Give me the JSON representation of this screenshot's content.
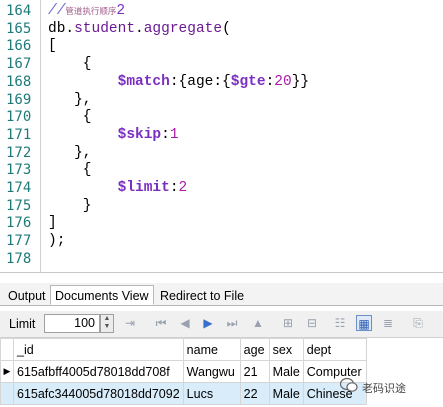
{
  "editor": {
    "lines": [
      {
        "num": "164",
        "parts": [
          {
            "t": "//",
            "c": "cm"
          },
          {
            "t": "管道执行顺序",
            "c": "cm-small"
          },
          {
            "t": "2",
            "c": "cm-num"
          }
        ]
      },
      {
        "num": "165",
        "parts": [
          {
            "t": "db.",
            "c": ""
          },
          {
            "t": "student",
            "c": "obj"
          },
          {
            "t": ".",
            "c": ""
          },
          {
            "t": "aggregate",
            "c": "obj"
          },
          {
            "t": "(",
            "c": ""
          }
        ]
      },
      {
        "num": "166",
        "parts": [
          {
            "t": "[",
            "c": ""
          }
        ]
      },
      {
        "num": "167",
        "parts": [
          {
            "t": "    {",
            "c": ""
          }
        ]
      },
      {
        "num": "168",
        "parts": [
          {
            "t": "        ",
            "c": ""
          },
          {
            "t": "$match",
            "c": "op"
          },
          {
            "t": ":{age:{",
            "c": ""
          },
          {
            "t": "$gte",
            "c": "op"
          },
          {
            "t": ":",
            "c": ""
          },
          {
            "t": "20",
            "c": "num"
          },
          {
            "t": "}}",
            "c": ""
          }
        ]
      },
      {
        "num": "169",
        "parts": [
          {
            "t": "   },",
            "c": ""
          }
        ]
      },
      {
        "num": "170",
        "parts": [
          {
            "t": "    {",
            "c": ""
          }
        ]
      },
      {
        "num": "171",
        "parts": [
          {
            "t": "        ",
            "c": ""
          },
          {
            "t": "$skip",
            "c": "op"
          },
          {
            "t": ":",
            "c": ""
          },
          {
            "t": "1",
            "c": "num"
          }
        ]
      },
      {
        "num": "172",
        "parts": [
          {
            "t": "   },",
            "c": ""
          }
        ]
      },
      {
        "num": "173",
        "parts": [
          {
            "t": "    {",
            "c": ""
          }
        ]
      },
      {
        "num": "174",
        "parts": [
          {
            "t": "        ",
            "c": ""
          },
          {
            "t": "$limit",
            "c": "op"
          },
          {
            "t": ":",
            "c": ""
          },
          {
            "t": "2",
            "c": "num"
          }
        ]
      },
      {
        "num": "175",
        "parts": [
          {
            "t": "    }",
            "c": ""
          }
        ]
      },
      {
        "num": "176",
        "parts": [
          {
            "t": "]",
            "c": ""
          }
        ]
      },
      {
        "num": "177",
        "parts": [
          {
            "t": ");",
            "c": ""
          }
        ]
      },
      {
        "num": "178",
        "parts": []
      }
    ]
  },
  "tabs": [
    {
      "label": "Output",
      "active": false
    },
    {
      "label": "Documents View",
      "active": true
    },
    {
      "label": "Redirect to File",
      "active": false
    }
  ],
  "toolbar": {
    "limit_label": "Limit",
    "limit_value": "100"
  },
  "grid": {
    "columns": [
      "_id",
      "name",
      "age",
      "sex",
      "dept"
    ],
    "rows": [
      {
        "indicator": "▶",
        "selected": false,
        "cells": [
          "615afbff4005d78018dd708f",
          "Wangwu",
          "21",
          "Male",
          "Computer"
        ]
      },
      {
        "indicator": "",
        "selected": true,
        "cells": [
          "615afc344005d78018dd7092",
          "Lucs",
          "22",
          "Male",
          "Chinese"
        ]
      }
    ]
  },
  "watermark": "老码识途",
  "colors": {
    "operator": "#7b2fbf",
    "number": "#a81ca8",
    "line_number": "#1f7a7a",
    "selected_row": "#d8ecf9"
  }
}
